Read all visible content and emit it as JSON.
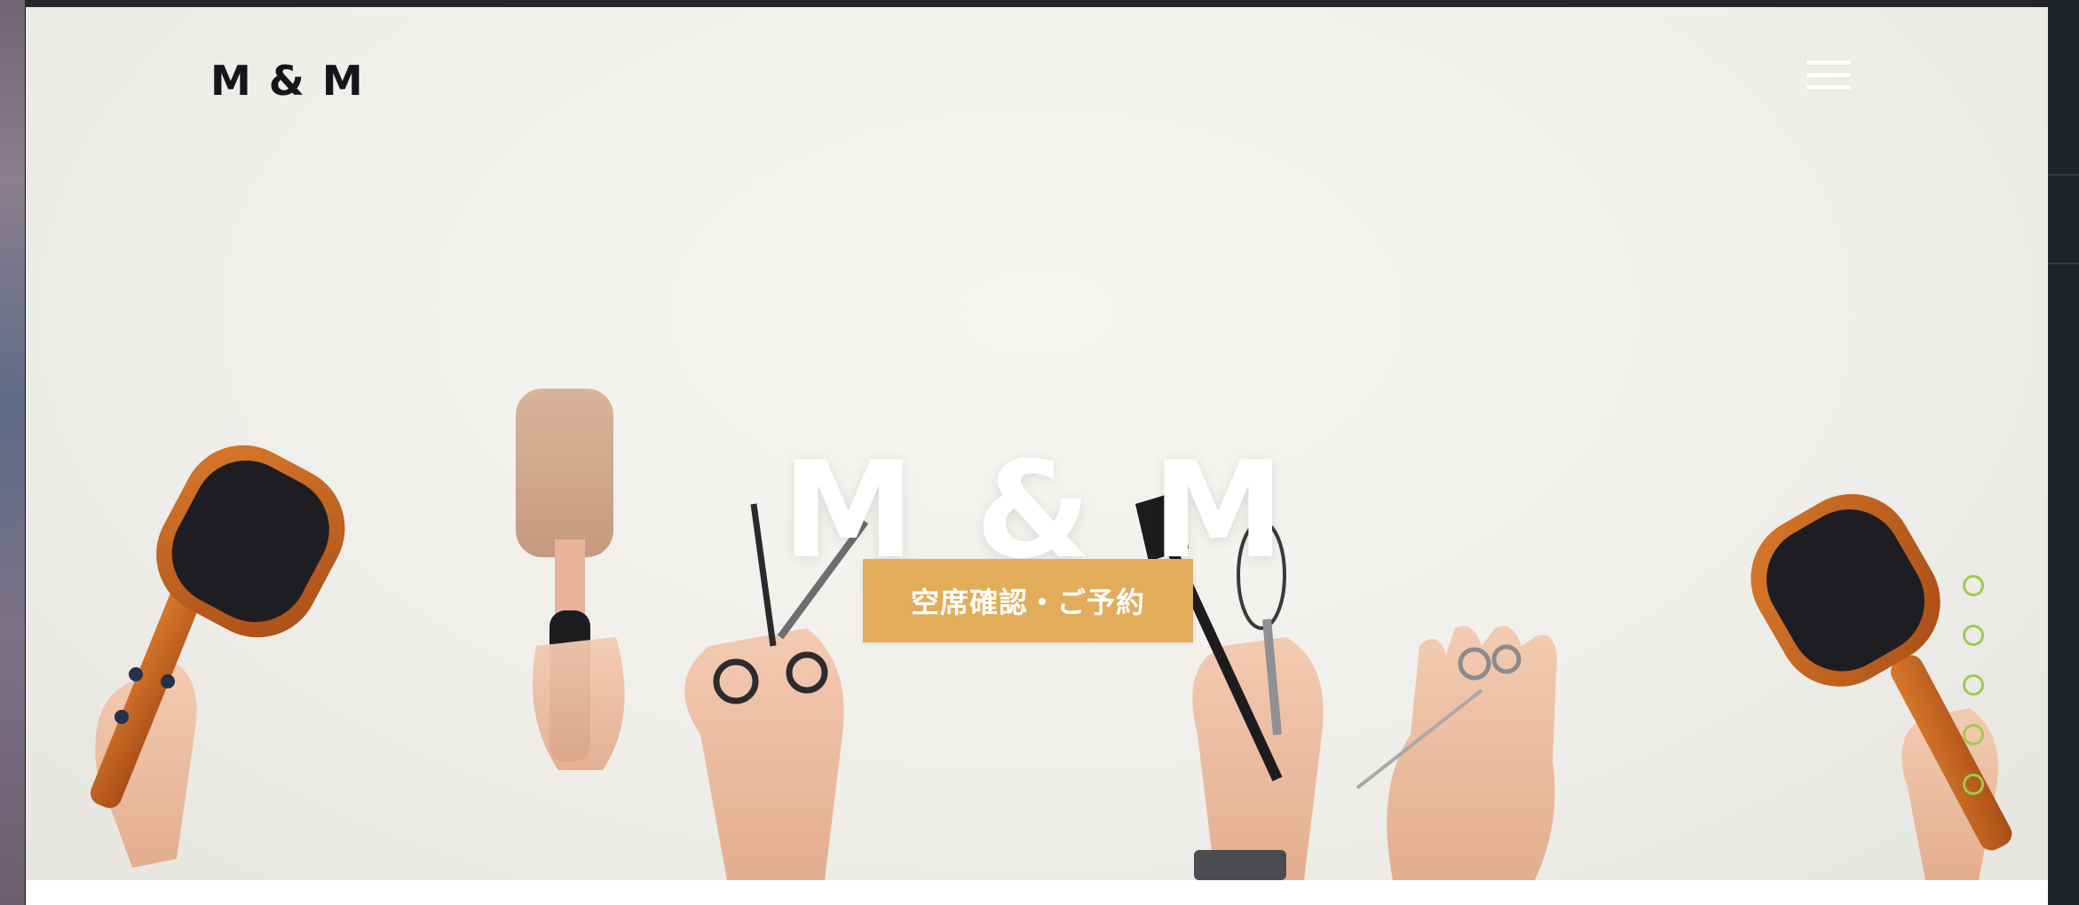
{
  "site": {
    "logo_text": "M & M"
  },
  "hero": {
    "title": "M & M",
    "reserve_button_label": "空席確認・ご予約"
  },
  "slider": {
    "dot_count": 5,
    "active_index": 0
  },
  "colors": {
    "accent_button": "#e2ad5b",
    "dot_outline": "#9ccc4a",
    "logo_text": "#15161a",
    "hero_background": "#f0efeb"
  },
  "icons": {
    "menu": "hamburger-menu-icon"
  }
}
